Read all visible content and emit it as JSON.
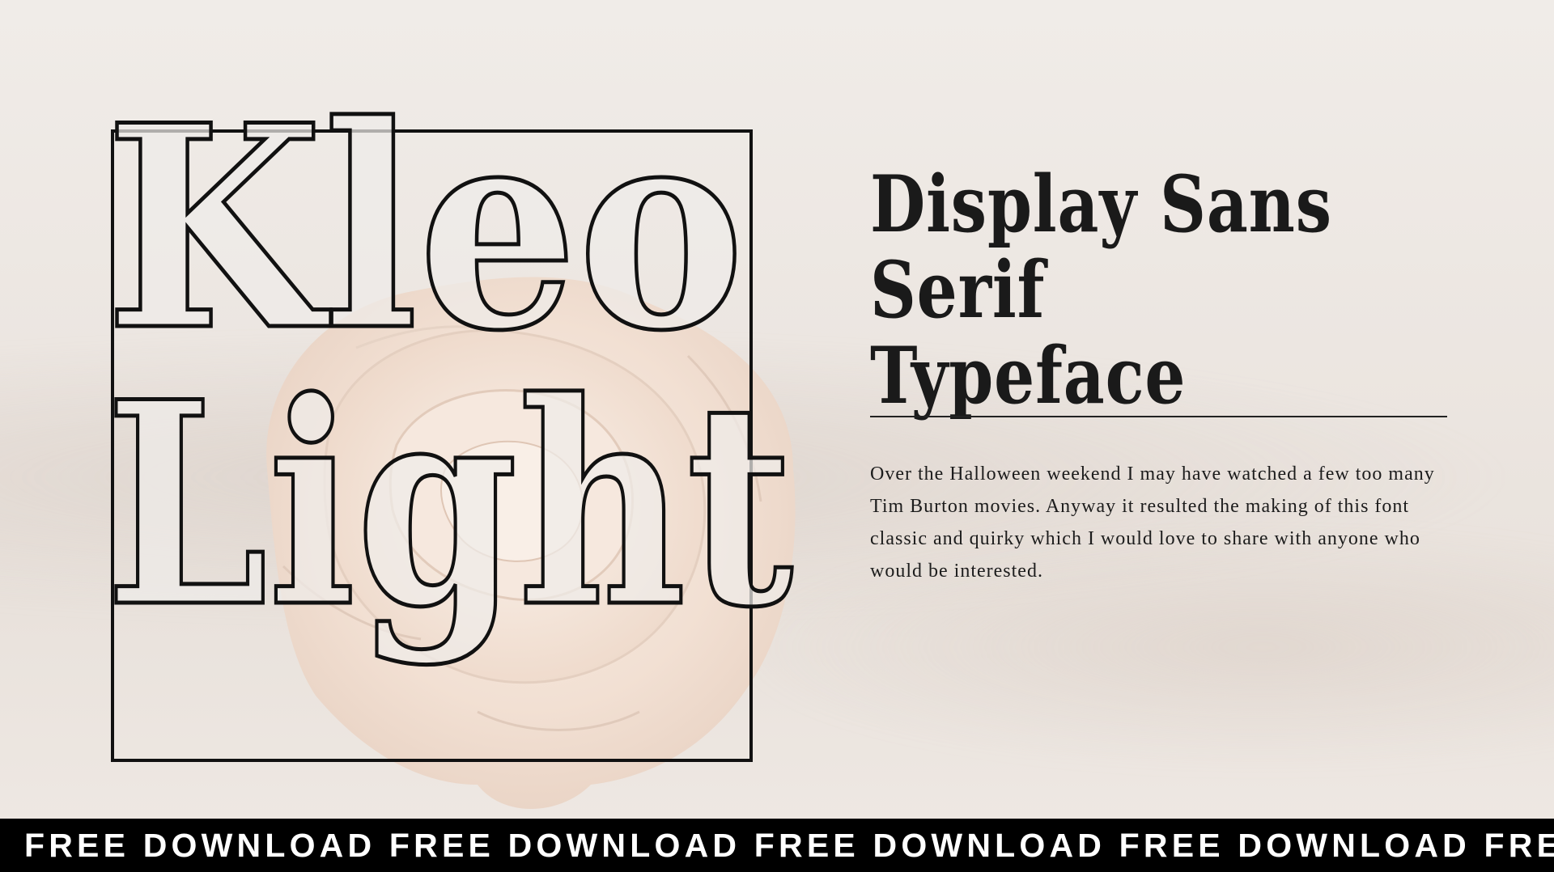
{
  "title": {
    "line1": "Kleo",
    "line2": "Light"
  },
  "headline": "Display Sans Serif Typeface",
  "description": "Over the Halloween weekend I may have watched a few too many Tim Burton movies. Anyway it resulted the making of this font classic and quirky which I would love to share with anyone who would be interested.",
  "banner": {
    "text": "FREE DOWNLOAD FREE DOWNLOAD FREE DOWNLOAD FREE DOWNLOAD FREE"
  },
  "colors": {
    "background": "#ece6e1",
    "text": "#1a1a1a",
    "banner_bg": "#000000",
    "banner_text": "#ffffff",
    "flower": "#f3e2d6"
  },
  "decor": {
    "flower": "white-rose-image"
  }
}
